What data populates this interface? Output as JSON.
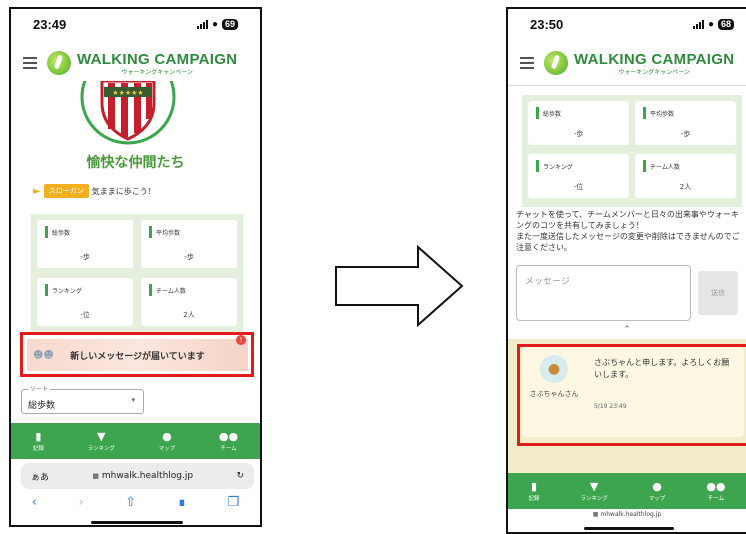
{
  "left": {
    "time": "23:49",
    "battery": "69",
    "app_title": "WALKING CAMPAIGN",
    "app_subtitle": "ウォーキングキャンペーン",
    "team_name": "愉快な仲間たち",
    "slogan_tag": "スローガン",
    "slogan_text": "気ままに歩こう！",
    "stats": [
      {
        "label": "総歩数",
        "value": "-歩"
      },
      {
        "label": "平均歩数",
        "value": "-歩"
      },
      {
        "label": "ランキング",
        "value": "-位"
      },
      {
        "label": "チーム人数",
        "value": "2人"
      }
    ],
    "banner_text": "新しいメッセージが届いています",
    "banner_badge": "!",
    "sort_legend": "ソート",
    "sort_value": "総歩数",
    "nav": [
      {
        "label": "記録",
        "icon": "chart-icon"
      },
      {
        "label": "ランキング",
        "icon": "trophy-icon"
      },
      {
        "label": "マップ",
        "icon": "map-pin-icon"
      },
      {
        "label": "チーム",
        "icon": "team-icon"
      }
    ],
    "browser_aa": "ぁあ",
    "url": "mhwalk.healthlog.jp"
  },
  "right": {
    "time": "23:50",
    "battery": "68",
    "app_title": "WALKING CAMPAIGN",
    "app_subtitle": "ウォーキングキャンペーン",
    "stats": [
      {
        "label": "総歩数",
        "value": "-歩"
      },
      {
        "label": "平均歩数",
        "value": "-歩"
      },
      {
        "label": "ランキング",
        "value": "-位"
      },
      {
        "label": "チーム人数",
        "value": "2人"
      }
    ],
    "chat_intro": "チャットを使って、チームメンバーと日々の出来事やウォーキングのコツを共有してみましょう！\nまた一度送信したメッセージの変更や削除はできませんのでご注意ください。",
    "message_placeholder": "メッセージ",
    "send_label": "送信",
    "message_author": "さぶちゃんさん",
    "message_text": "さぶちゃんと申します。よろしくお願いします。",
    "message_time": "5/19 23:49",
    "nav": [
      {
        "label": "記録",
        "icon": "chart-icon"
      },
      {
        "label": "ランキング",
        "icon": "trophy-icon"
      },
      {
        "label": "マップ",
        "icon": "map-pin-icon"
      },
      {
        "label": "チーム",
        "icon": "team-icon"
      }
    ],
    "url": "mhwalk.healthlog.jp"
  },
  "colors": {
    "brand_green": "#3da54f",
    "highlight_red": "#e21b1b",
    "stats_bg": "#e4efde",
    "message_bg": "#fbf7e2"
  }
}
